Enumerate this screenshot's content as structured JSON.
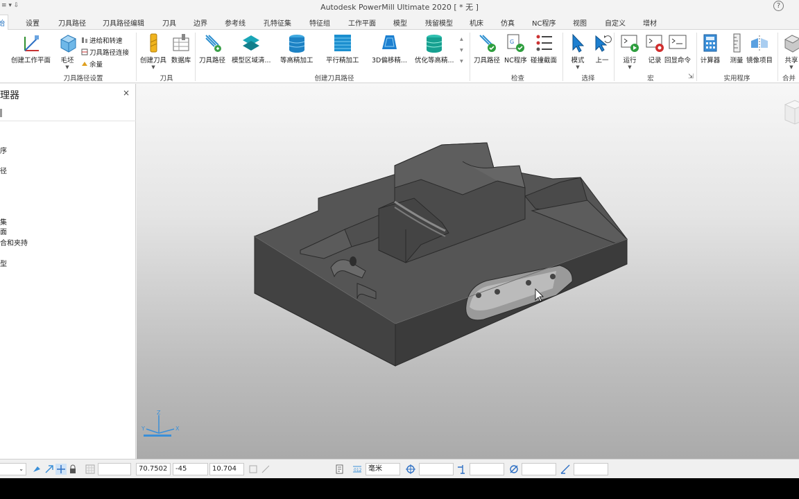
{
  "titlebar": {
    "quick_access": "≡ ▾ ⇩",
    "title": "Autodesk PowerMill Ultimate 2020    [ * 无 ]",
    "help": "?"
  },
  "tabs": [
    "开始",
    "设置",
    "刀具路径",
    "刀具路径编辑",
    "刀具",
    "边界",
    "参考线",
    "孔特征集",
    "特征组",
    "工作平面",
    "模型",
    "残留模型",
    "机床",
    "仿真",
    "NC程序",
    "视图",
    "自定义",
    "增材"
  ],
  "ribbon": {
    "groups": {
      "toolpath_setup": "刀具路径设置",
      "tool": "刀具",
      "create_toolpath": "创建刀具路径",
      "check": "检查",
      "select": "选择",
      "macro": "宏",
      "utilities": "实用程序",
      "merge": "合并"
    },
    "buttons": {
      "create_workplane": "创建工作平面",
      "block": "毛坯",
      "feeds_speeds": "进给和转速",
      "toolpath_connections": "刀具路径连接",
      "thickness": "余量",
      "create_tool": "创建刀具",
      "database": "数据库",
      "toolpaths": "刀具路径",
      "model_area_clear": "模型区域清...",
      "constant_z_finish": "等高精加工",
      "raster_finish": "平行精加工",
      "offset_3d": "3D偏移精...",
      "optimised_constant_z": "优化等高精...",
      "check_toolpath": "刀具路径",
      "check_nc": "NC程序",
      "collision_section": "碰撞截面",
      "mode": "模式",
      "previous": "上一",
      "run": "运行",
      "record": "记录",
      "echo_commands": "回显命令",
      "calculator": "计算器",
      "measure": "测量",
      "mirror": "镜像项目",
      "share": "共享"
    }
  },
  "explorer": {
    "title": "理器",
    "close": "×",
    "items": [
      "序",
      "径",
      "集",
      "面",
      "合和夹持",
      "型"
    ]
  },
  "statusbar": {
    "x": "70.7502",
    "y": "-45",
    "z": "10.704",
    "units": "毫米"
  },
  "axes": {
    "x": "X",
    "y": "Y",
    "z": "Z"
  },
  "colors": {
    "accent": "#1f6fbf",
    "model_top": "#5a5a5a",
    "model_side": "#3e3e3e"
  }
}
